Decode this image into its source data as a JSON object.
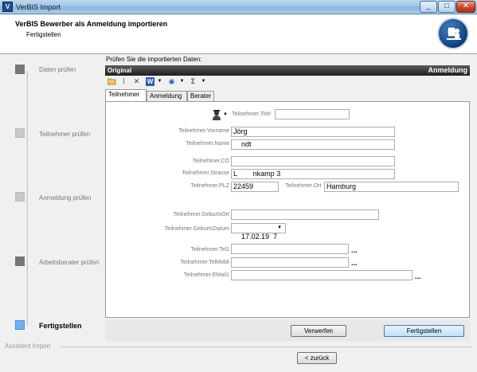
{
  "window": {
    "title": "VerBIS Import",
    "app_icon": "V"
  },
  "header": {
    "title": "VerBIS Bewerber als Anmeldung importieren",
    "subtitle": "Fertigstellen",
    "logo_icon": "person-at-desk-icon"
  },
  "steps": [
    {
      "label": "Daten prüfen",
      "state": "done"
    },
    {
      "label": "Teilnehmer prüfen",
      "state": "pending"
    },
    {
      "label": "Anmeldung prüfen",
      "state": "pending"
    },
    {
      "label": "Arbeitsberater prüfen",
      "state": "done"
    },
    {
      "label": "Fertigstellen",
      "state": "active"
    }
  ],
  "main": {
    "heading": "Prüfen Sie die importierten Daten:",
    "original_label": "Original",
    "section_label": "Anmeldung",
    "toolbar_icons": [
      "folder-open-icon",
      "paperclip-icon",
      "delete-icon",
      "word-icon",
      "globe-icon",
      "sum-icon"
    ],
    "tabs": [
      "Teilnehmer",
      "Anmeldung",
      "Berater"
    ],
    "active_tab": "Teilnehmer"
  },
  "form": {
    "titel": {
      "label": "Teilnehmer.Titel",
      "value": ""
    },
    "vorname": {
      "label": "Teilnehmer.Vorname",
      "value": "Jörg"
    },
    "name": {
      "label": "Teilnehmer.Name",
      "value": "    ndt"
    },
    "co": {
      "label": "Teilnehmer.CO",
      "value": ""
    },
    "strasse": {
      "label": "Teilnehmer.Strasse",
      "value": "L        nkamp 3"
    },
    "plz": {
      "label": "Teilnehmer.PLZ",
      "value": "22459"
    },
    "ort": {
      "label": "Teilnehmer.Ort",
      "value": "Hamburg"
    },
    "geburtsort": {
      "label": "Teilnehmer.GeburtsOrt",
      "value": ""
    },
    "geburtsdatum": {
      "label": "Teilnehmer.GeburtsDatum",
      "value": "17.02.19  7"
    },
    "tel1": {
      "label": "Teilnehmer.Tel1",
      "value": "",
      "ellipsis": "..."
    },
    "telmobil": {
      "label": "Teilnehmer.TelMobil",
      "value": "",
      "ellipsis": "..."
    },
    "email1": {
      "label": "Teilnehmer.EMail1",
      "value": "",
      "ellipsis": "..."
    }
  },
  "buttons": {
    "discard": "Verwerfen",
    "finish": "Fertigstellen",
    "back": "< zurück"
  },
  "footer": {
    "group_label": "Assistent Import"
  },
  "colors": {
    "accent": "#4a90d9",
    "step_done": "#777777",
    "step_pending": "#c8c8c8",
    "step_active": "#6fb1ec"
  }
}
